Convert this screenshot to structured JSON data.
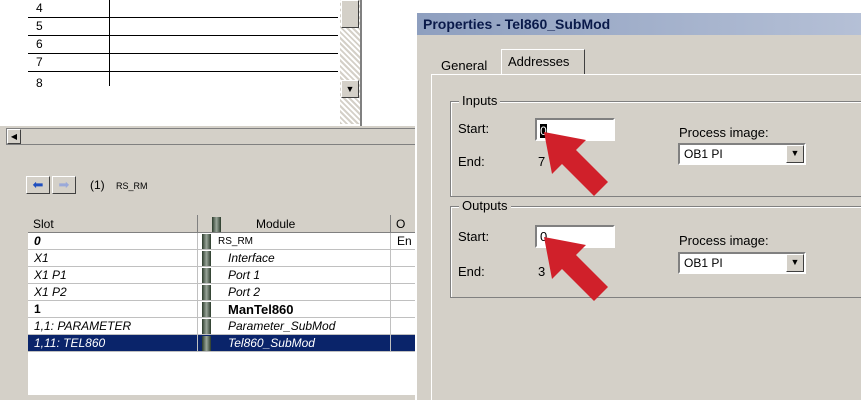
{
  "slot_list": {
    "rows": [
      "4",
      "5",
      "6",
      "7",
      "8"
    ]
  },
  "rack": {
    "number": "(1)",
    "name": "RS_RM"
  },
  "module_table": {
    "headers": [
      "Slot",
      "Module",
      "O"
    ],
    "rows": [
      {
        "slot": "0",
        "module": "RS_RM",
        "extra": "En",
        "style": "bold-italic"
      },
      {
        "slot": "X1",
        "module": "Interface",
        "extra": "",
        "style": "italic"
      },
      {
        "slot": "X1 P1",
        "module": "Port 1",
        "extra": "",
        "style": "italic"
      },
      {
        "slot": "X1 P2",
        "module": "Port 2",
        "extra": "",
        "style": "italic"
      },
      {
        "slot": "1",
        "module": "ManTel860",
        "extra": "",
        "style": "bold"
      },
      {
        "slot": "1,1: PARAMETER",
        "module": "Parameter_SubMod",
        "extra": "",
        "style": "italic"
      },
      {
        "slot": "1,11: TEL860",
        "module": "Tel860_SubMod",
        "extra": "",
        "style": "selected"
      }
    ]
  },
  "dialog": {
    "title": "Properties - Tel860_SubMod",
    "tabs": [
      "General",
      "Addresses"
    ],
    "active_tab": "Addresses",
    "inputs": {
      "legend": "Inputs",
      "start_label": "Start:",
      "start_value": "0",
      "end_label": "End:",
      "end_value": "7",
      "process_image_label": "Process image:",
      "process_image_value": "OB1 PI"
    },
    "outputs": {
      "legend": "Outputs",
      "start_label": "Start:",
      "start_value": "0",
      "end_label": "End:",
      "end_value": "3",
      "process_image_label": "Process image:",
      "process_image_value": "OB1 PI"
    }
  },
  "colors": {
    "highlight_arrow": "#d0202a",
    "selection": "#0a246a",
    "window_bg": "#d4d0c8"
  }
}
